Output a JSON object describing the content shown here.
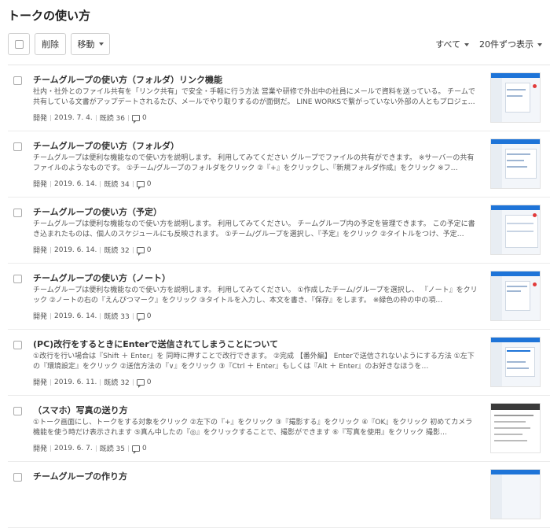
{
  "page": {
    "title": "トークの使い方"
  },
  "toolbar": {
    "delete_label": "削除",
    "move_label": "移動",
    "filter_all": "すべて",
    "per_page": "20件ずつ表示"
  },
  "colors": {
    "accent": "#1e74d8",
    "text": "#333333",
    "muted": "#555555"
  },
  "icons": {
    "comment": "comment-icon",
    "caret": "chevron-down-icon"
  },
  "posts": [
    {
      "title": "チームグループの使い方（フォルダ）リンク機能",
      "desc": " 社内・社外とのファイル共有を「リンク共有」で安全・手軽に行う方法 営業や研修で外出中の社員にメールで資料を送っている。 チームで共有している文書がアップデートされるたび、メールでやり取りするのが面倒だ。 LINE WORKSで繋がっていない外部の人ともプロジェ…",
      "author": "開発",
      "date": "2019. 7. 4.",
      "views": "既読 36",
      "comments": "0"
    },
    {
      "title": "チームグループの使い方（フォルダ）",
      "desc": "チームグループは便利な機能なので使い方を説明します。 利用してみてください グループでファイルの共有ができます。 ※サーバーの共有ファイルのようなものです。 ①チーム/グループのフォルダをクリック ②『+』をクリックし、『新規フォルダ作成』をクリック ※フ…",
      "author": "開発",
      "date": "2019. 6. 14.",
      "views": "既読 34",
      "comments": "0"
    },
    {
      "title": "チームグループの使い方（予定）",
      "desc": "チームグループは便利な機能なので使い方を説明します。 利用してみてください。 チームグループ内の予定を管理できます。 この予定に書き込まれたものは、個人のスケジュールにも反映されます。 ①チーム/グループを選択し、『予定』をクリック ②タイトルをつけ、予定…",
      "author": "開発",
      "date": "2019. 6. 14.",
      "views": "既読 32",
      "comments": "0"
    },
    {
      "title": "チームグループの使い方（ノート）",
      "desc": "チームグループは便利な機能なので使い方を説明します。 利用してみてください。 ①作成したチーム/グループを選択し、 『ノート』をクリック ②ノートの右の『えんぴつマーク』をクリック ③タイトルを入力し、本文を書き、『保存』をします。 ※緑色の枠の中の項…",
      "author": "開発",
      "date": "2019. 6. 14.",
      "views": "既読 33",
      "comments": "0"
    },
    {
      "title": "(PC)改行をするときにEnterで送信されてしまうことについて",
      "desc": "①改行を行い場合は『Shift ＋ Enter』を 同時に押すことで改行できます。 ②完成 【番外編】 Enterで送信されないようにする方法 ①左下の『環境設定』をクリック ②送信方法の『∨』をクリック ③『Ctrl ＋ Enter』もしくは『Alt ＋ Enter』のお好きなほうを…",
      "author": "開発",
      "date": "2019. 6. 11.",
      "views": "既読 32",
      "comments": "0"
    },
    {
      "title": "（スマホ）写真の送り方",
      "desc": "①トーク画面にし、トークをする対象をクリック ②左下の『+』をクリック ③『撮影する』をクリック ④『OK』をクリック 初めてカメラ機能を使う時だけ表示されます ⑤真ん中したの『◎』をクリックすることで、撮影ができます ⑥『写真を使用』をクリック 撮影…",
      "author": "開発",
      "date": "2019. 6. 7.",
      "views": "既読 35",
      "comments": "0"
    },
    {
      "title": "チームグループの作り方",
      "desc": "",
      "author": "",
      "date": "",
      "views": "",
      "comments": ""
    }
  ]
}
